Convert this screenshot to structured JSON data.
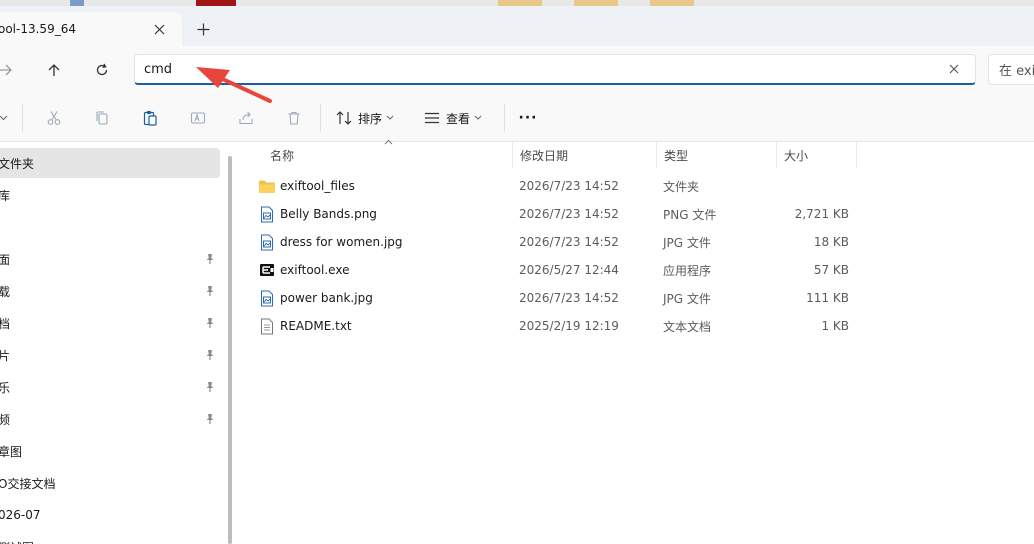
{
  "window": {
    "tab_title": "ool-13.59_64",
    "tab_close_icon": "close-icon",
    "new_tab_icon": "plus-icon"
  },
  "nav": {
    "forward_icon": "arrow-right-icon",
    "up_icon": "arrow-up-icon",
    "refresh_icon": "refresh-icon",
    "address_value": "cmd",
    "clear_icon": "close-icon",
    "search_placeholder": "在 exi"
  },
  "toolbar": {
    "sort_label": "排序",
    "view_label": "查看",
    "more_label": "···"
  },
  "sidebar": {
    "items": [
      {
        "label": "文件夹",
        "pinned": false,
        "selected": true
      },
      {
        "label": "库",
        "pinned": false,
        "selected": false
      },
      {
        "label": "面",
        "pinned": true,
        "selected": false
      },
      {
        "label": "载",
        "pinned": true,
        "selected": false
      },
      {
        "label": "档",
        "pinned": true,
        "selected": false
      },
      {
        "label": "片",
        "pinned": true,
        "selected": false
      },
      {
        "label": "乐",
        "pinned": true,
        "selected": false
      },
      {
        "label": "频",
        "pinned": true,
        "selected": false
      },
      {
        "label": "章图",
        "pinned": false,
        "selected": false
      },
      {
        "label": "O交接文档",
        "pinned": false,
        "selected": false
      },
      {
        "label": "026-07",
        "pinned": false,
        "selected": false
      },
      {
        "label": "测试图",
        "pinned": false,
        "selected": false
      }
    ]
  },
  "columns": {
    "name": "名称",
    "date": "修改日期",
    "type": "类型",
    "size": "大小"
  },
  "files": [
    {
      "name": "exiftool_files",
      "date": "2026/7/23 14:52",
      "type": "文件夹",
      "size": "",
      "icon": "folder-icon"
    },
    {
      "name": "Belly Bands.png",
      "date": "2026/7/23 14:52",
      "type": "PNG 文件",
      "size": "2,721 KB",
      "icon": "image-file-icon"
    },
    {
      "name": "dress for women.jpg",
      "date": "2026/7/23 14:52",
      "type": "JPG 文件",
      "size": "18 KB",
      "icon": "image-file-icon"
    },
    {
      "name": "exiftool.exe",
      "date": "2026/5/27 12:44",
      "type": "应用程序",
      "size": "57 KB",
      "icon": "exe-icon"
    },
    {
      "name": "power bank.jpg",
      "date": "2026/7/23 14:52",
      "type": "JPG 文件",
      "size": "111 KB",
      "icon": "image-file-icon"
    },
    {
      "name": "README.txt",
      "date": "2025/2/19 12:19",
      "type": "文本文档",
      "size": "1 KB",
      "icon": "text-file-icon"
    }
  ],
  "colors": {
    "accent": "#1b5e9e",
    "annotation_arrow": "#e8463a",
    "folder": "#f5c04a",
    "selected_bg": "#e5e5e5"
  }
}
